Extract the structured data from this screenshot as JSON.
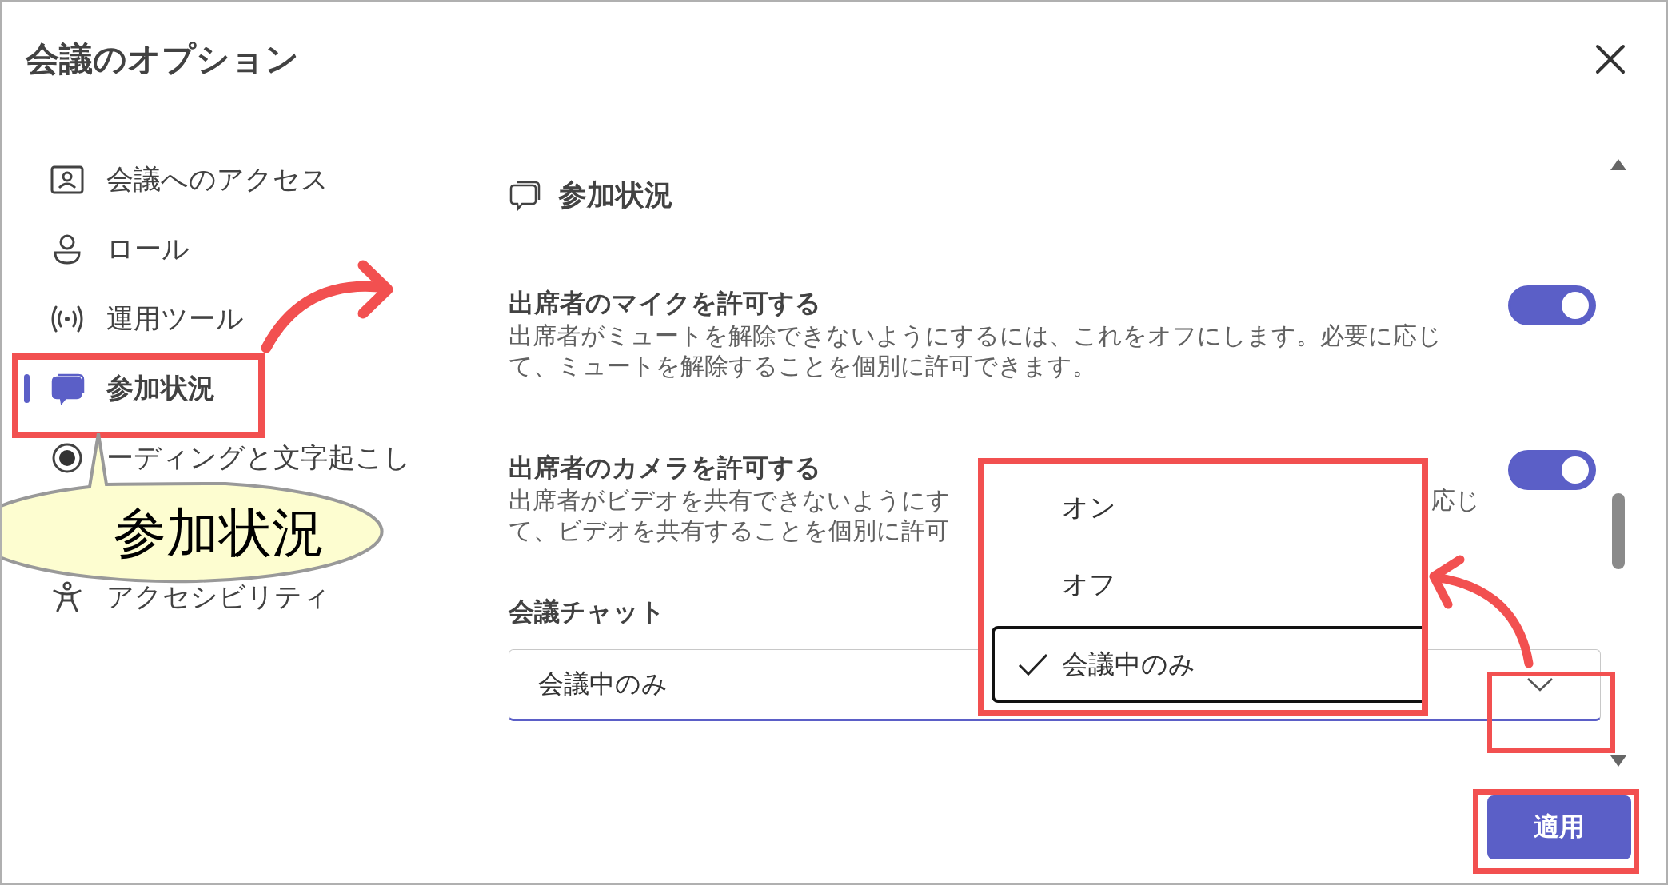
{
  "dialog": {
    "title": "会議のオプション"
  },
  "sidebar": {
    "items": [
      {
        "label": "会議へのアクセス",
        "selected": false
      },
      {
        "label": "ロール",
        "selected": false
      },
      {
        "label": "運用ツール",
        "selected": false
      },
      {
        "label": "参加状況",
        "selected": true
      },
      {
        "label": "ーディングと文字起こし",
        "selected": false
      },
      {
        "label": "アクセシビリティ",
        "selected": false
      }
    ]
  },
  "section": {
    "title": "参加状況",
    "settings": [
      {
        "title": "出席者のマイクを許可する",
        "description_lines": [
          [
            "出席者がミュートを解除できないようにするには、これをオフにします。必要に応じ"
          ],
          [
            "て、ミュートを解除することを個別に許可できます。"
          ]
        ],
        "on": true
      },
      {
        "title": "出席者のカメラを許可する",
        "description_lines": [
          [
            "出席者がビデオを共有できないようにす",
            "応じ"
          ],
          [
            "て、ビデオを共有することを個別に許可"
          ]
        ],
        "on": true
      }
    ],
    "chat": {
      "label": "会議チャット",
      "value": "会議中のみ",
      "menu": [
        {
          "label": "オン",
          "selected": false
        },
        {
          "label": "オフ",
          "selected": false
        },
        {
          "label": "会議中のみ",
          "selected": true
        }
      ]
    }
  },
  "apply_button": "適用",
  "callout": {
    "text": "参加状況"
  }
}
